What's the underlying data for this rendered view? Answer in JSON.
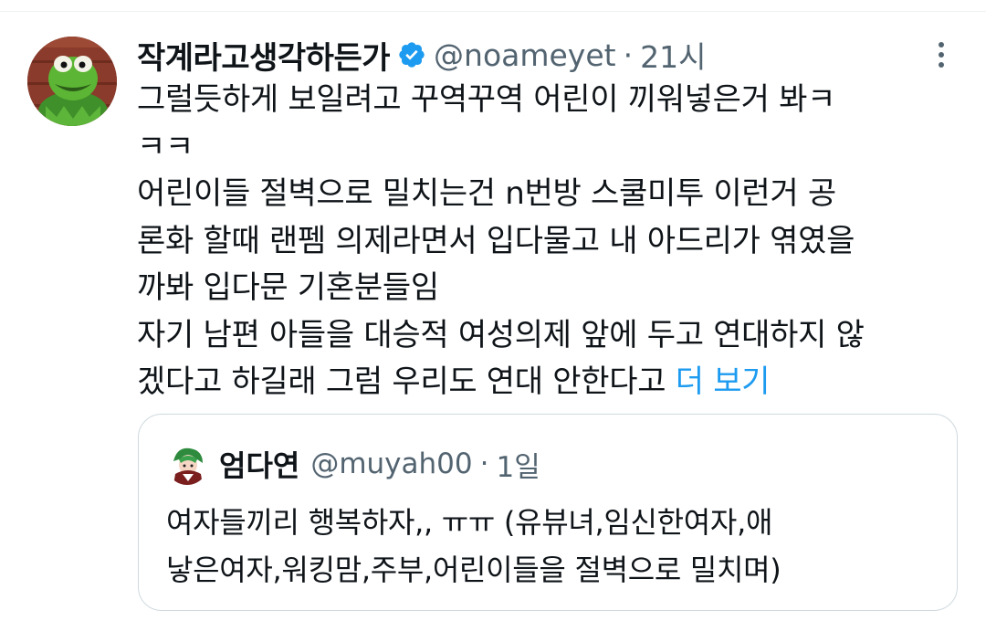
{
  "tweet": {
    "author": {
      "display_name": "작계라고생각하든가",
      "handle": "@noameyet",
      "verified": true,
      "avatar": "kermit-frog-avatar"
    },
    "separator": "·",
    "time": "21시",
    "body_lines": [
      "그럴듯하게 보일려고 꾸역꾸역 어린이 끼워넣은거 봐ㅋ",
      "ㅋㅋ",
      "어린이들 절벽으로 밀치는건 n번방 스쿨미투 이런거 공",
      "론화 할때 랜펨 의제라면서 입다물고 내 아드리가 엮였을",
      "까봐 입다문 기혼분들임",
      "자기 남편 아들을 대승적 여성의제 앞에 두고 연대하지 않",
      "겠다고 하길래 그럼 우리도 연대 안한다고"
    ],
    "show_more": "더 보기",
    "colors": {
      "text": "#0f1419",
      "secondary": "#536471",
      "link": "#1d9bf0",
      "border": "#cfd9de"
    }
  },
  "quoted_tweet": {
    "author": {
      "display_name": "엄다연",
      "handle": "@muyah00",
      "avatar": "anime-character-avatar"
    },
    "separator": "·",
    "time": "1일",
    "text_lines": [
      "여자들끼리 행복하자,, ㅠㅠ (유뷰녀,임신한여자,애",
      "낳은여자,워킹맘,주부,어린이들을 절벽으로 밀치며)"
    ]
  }
}
